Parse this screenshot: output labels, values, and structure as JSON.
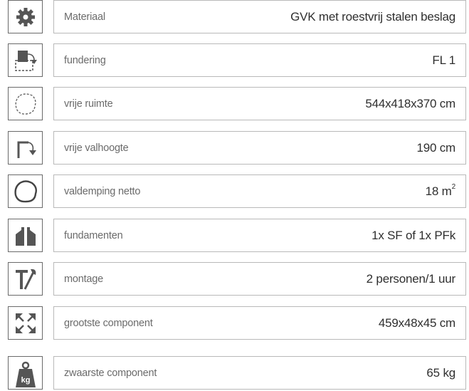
{
  "specs": [
    {
      "icon": "gear-icon",
      "label": "Materiaal",
      "value": "GVK met roestvrij stalen beslag"
    },
    {
      "icon": "foundation-plan-icon",
      "label": "fundering",
      "value": "FL 1"
    },
    {
      "icon": "free-space-icon",
      "label": "vrije ruimte",
      "value": "544x418x370 cm"
    },
    {
      "icon": "fall-height-icon",
      "label": "vrije valhoogte",
      "value": "190 cm"
    },
    {
      "icon": "impact-area-icon",
      "label": "valdemping netto",
      "value": "18 m",
      "value_sup": "2"
    },
    {
      "icon": "foundations-icon",
      "label": "fundamenten",
      "value": "1x SF of 1x PFk"
    },
    {
      "icon": "tools-icon",
      "label": "montage",
      "value": "2 personen/1 uur"
    },
    {
      "icon": "dimensions-icon",
      "label": "grootste component",
      "value": "459x48x45 cm"
    },
    {
      "icon": "weight-icon",
      "label": "zwaarste component",
      "value": "65 kg",
      "weight_icon_text": "kg"
    }
  ]
}
